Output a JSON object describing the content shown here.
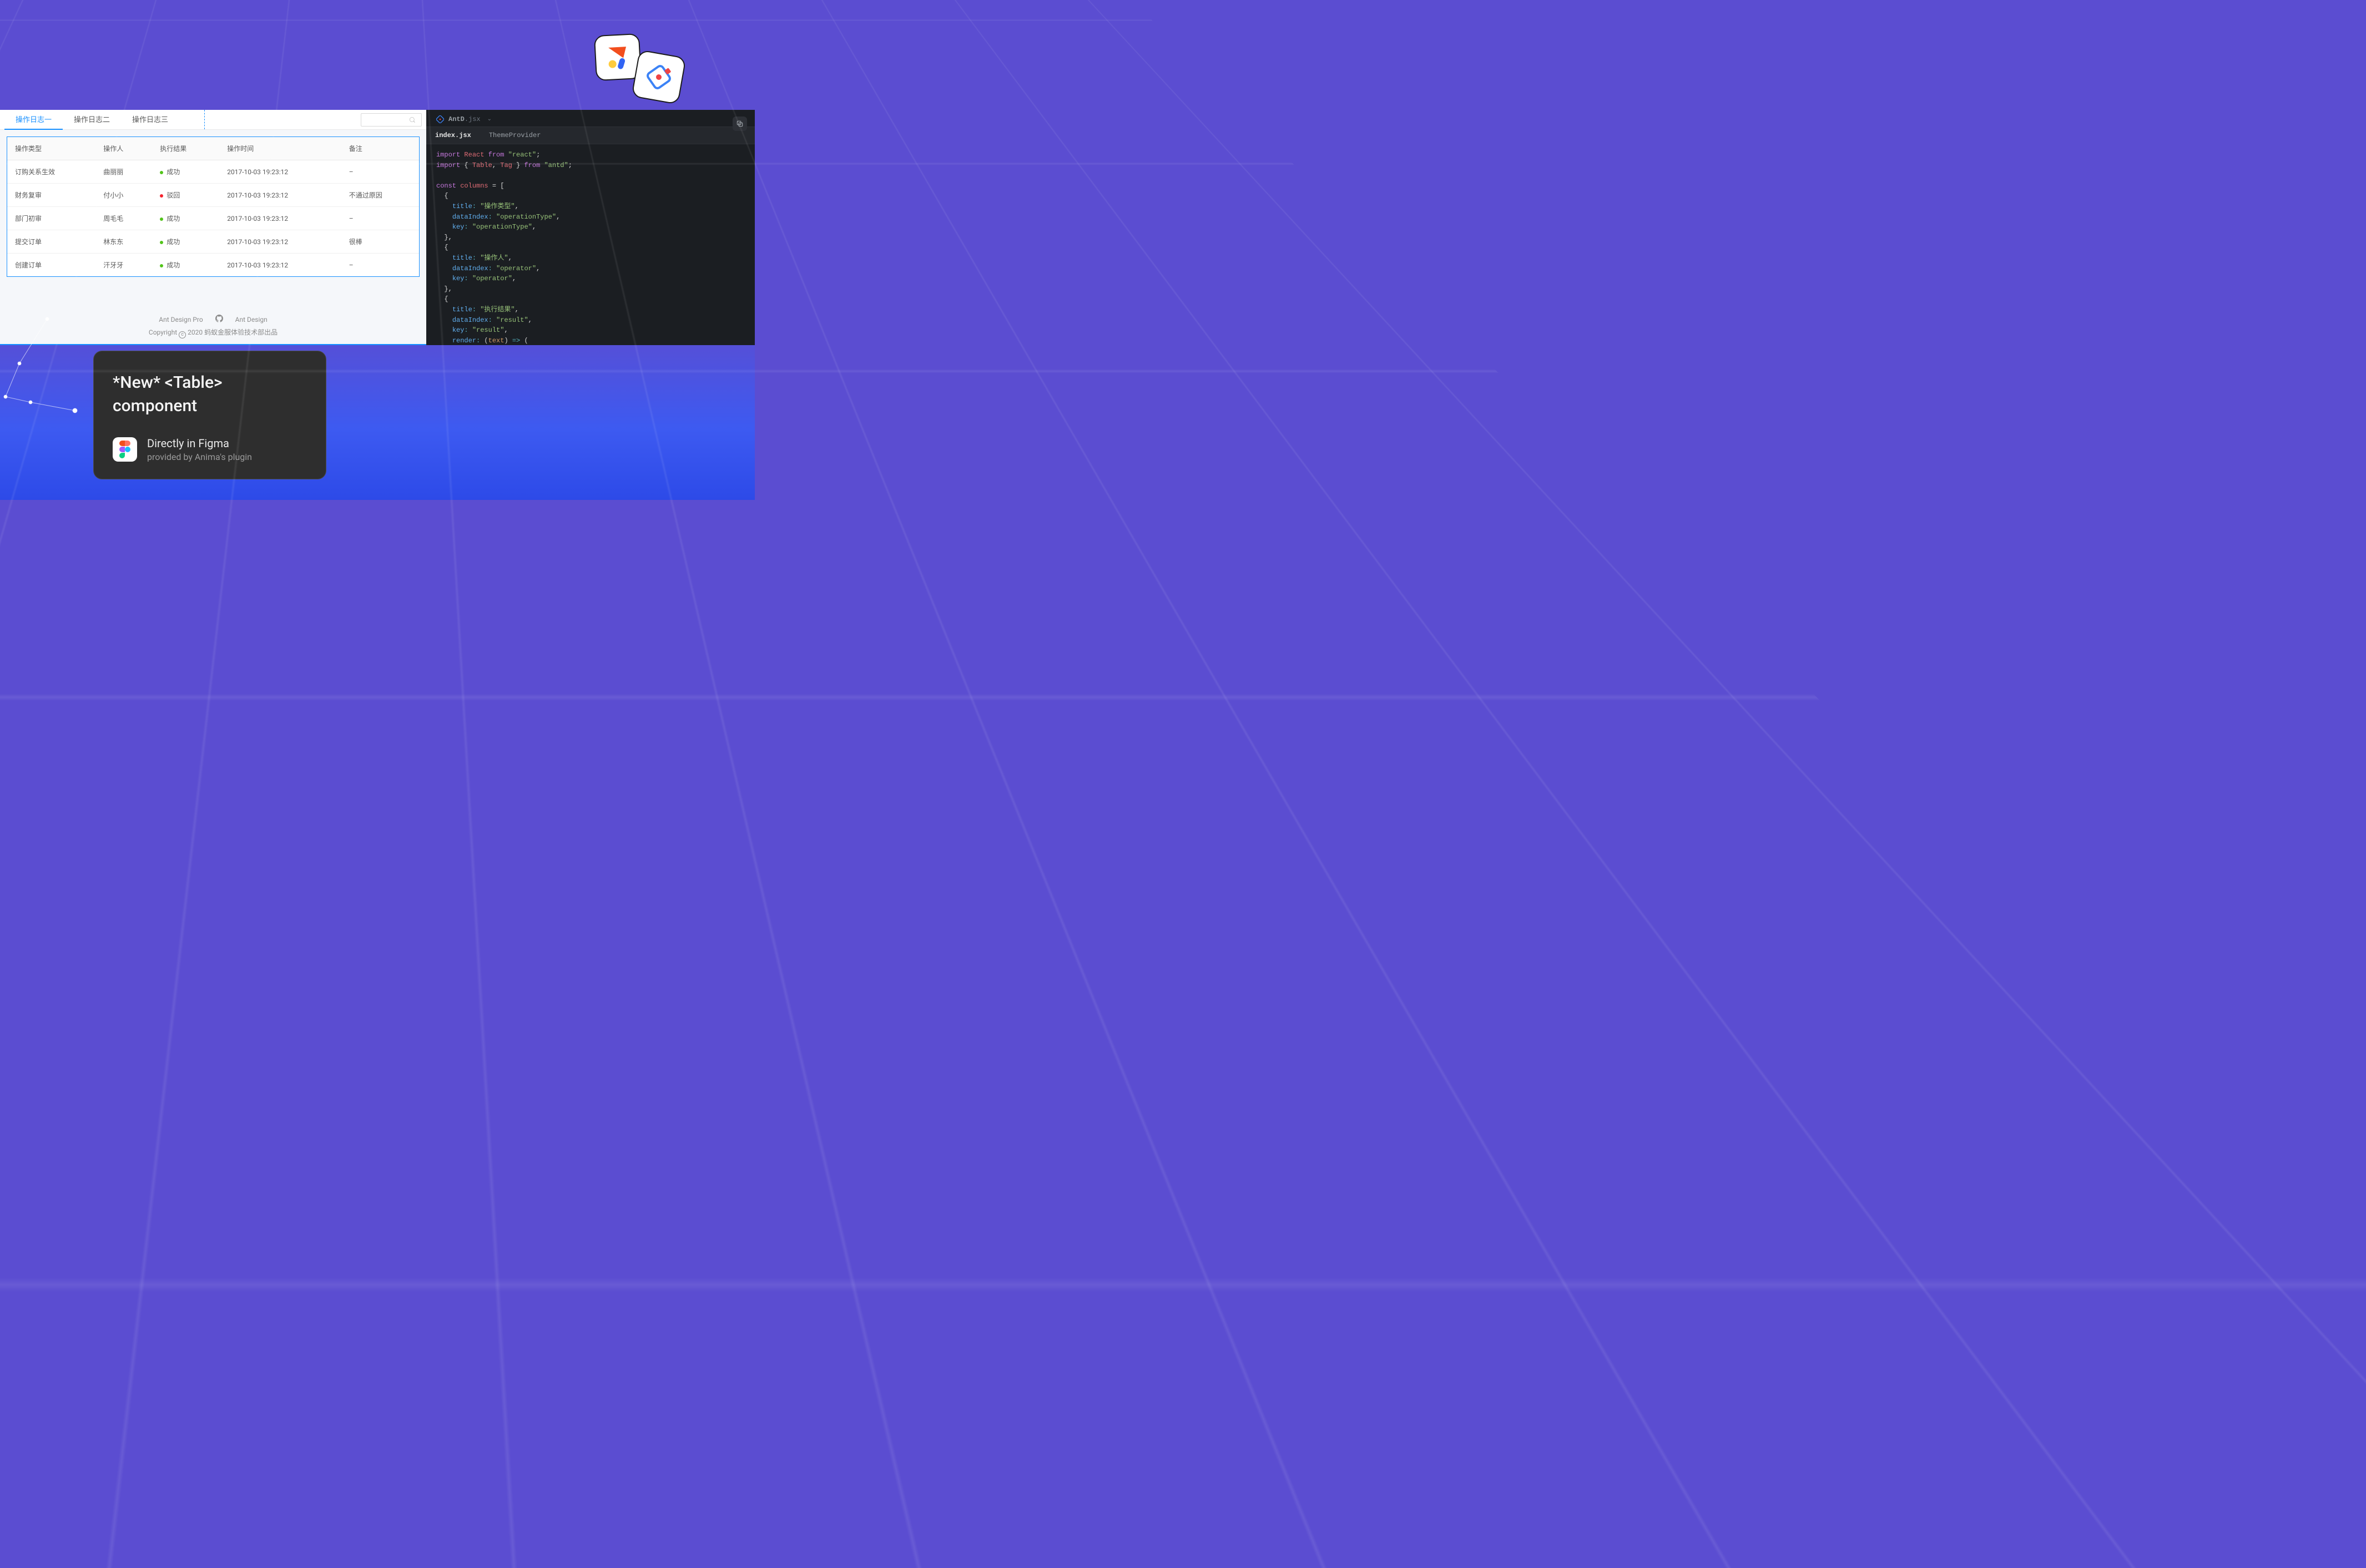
{
  "tabs": [
    "操作日志一",
    "操作日志二",
    "操作日志三"
  ],
  "active_tab_index": 0,
  "search_placeholder": "",
  "table": {
    "columns": [
      "操作类型",
      "操作人",
      "执行结果",
      "操作时间",
      "备注"
    ],
    "rows": [
      {
        "type": "订购关系生效",
        "operator": "曲丽丽",
        "result": "成功",
        "result_color": "green",
        "time": "2017-10-03  19:23:12",
        "note": "–"
      },
      {
        "type": "财务复审",
        "operator": "付小小",
        "result": "驳回",
        "result_color": "red",
        "time": "2017-10-03  19:23:12",
        "note": "不通过原因"
      },
      {
        "type": "部门初审",
        "operator": "周毛毛",
        "result": "成功",
        "result_color": "green",
        "time": "2017-10-03  19:23:12",
        "note": "–"
      },
      {
        "type": "提交订单",
        "operator": "林东东",
        "result": "成功",
        "result_color": "green",
        "time": "2017-10-03  19:23:12",
        "note": "很棒"
      },
      {
        "type": "创建订单",
        "operator": "汗牙牙",
        "result": "成功",
        "result_color": "green",
        "time": "2017-10-03  19:23:12",
        "note": "–"
      }
    ]
  },
  "footer": {
    "link1": "Ant Design Pro",
    "link2": "Ant Design",
    "copyright_prefix": "Copyright",
    "copyright_year": "2020",
    "copyright_text": "蚂蚁金服体验技术部出品"
  },
  "editor": {
    "file_label": "AntD",
    "file_ext": ".jsx",
    "tabs": [
      "index.jsx",
      "ThemeProvider"
    ],
    "active_tab_index": 0,
    "code_raw": "import React from \"react\";\nimport { Table, Tag } from \"antd\";\n\nconst columns = [\n  {\n    title: \"操作类型\",\n    dataIndex: \"operationType\",\n    key: \"operationType\",\n  },\n  {\n    title: \"操作人\",\n    dataIndex: \"operator\",\n    key: \"operator\",\n  },\n  {\n    title: \"执行结果\",\n    dataIndex: \"result\",\n    key: \"result\",\n    render: (text) => (\n      <span>\n        <Tag color={text === \"成功\" ? \"green\" : \"red\"}>{text}</Tag>\n      </span>\n    ),\n  },\n  {"
  },
  "promo": {
    "title_line1": "*New* <Table>",
    "title_line2": "component",
    "sub_line1": "Directly in Figma",
    "sub_line2": "provided by Anima's plugin"
  },
  "colors": {
    "accent": "#1890ff",
    "success": "#52c41a",
    "error": "#f5222d",
    "bg_purple": "#5b4dd1",
    "editor_bg": "#1b1e22"
  }
}
